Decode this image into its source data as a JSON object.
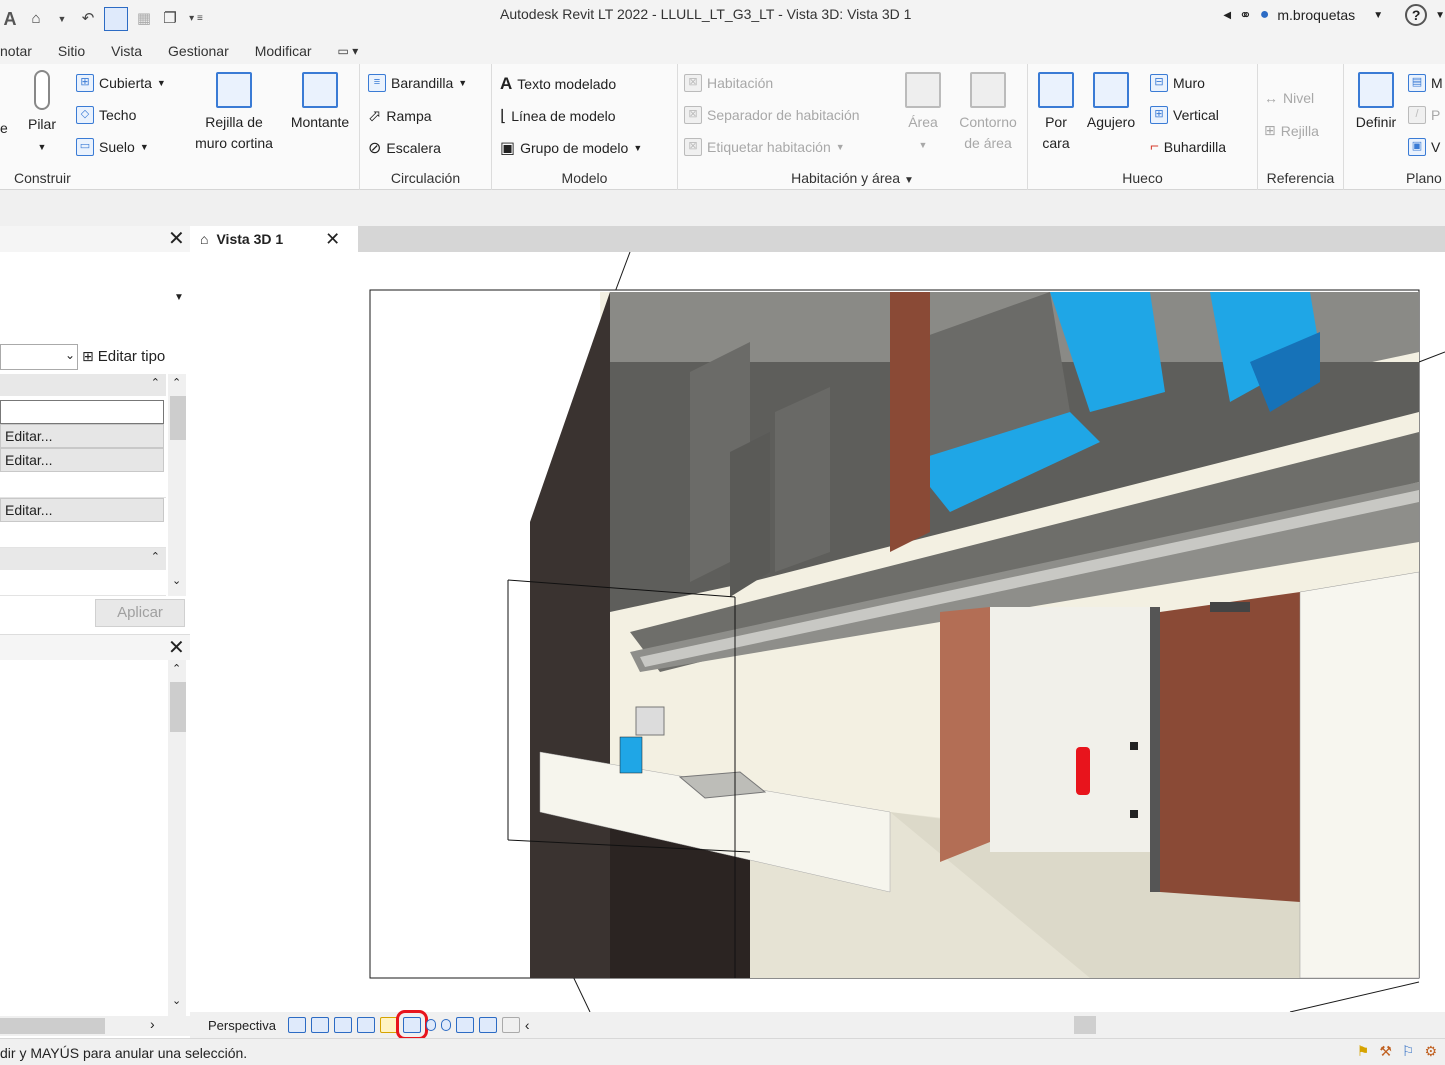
{
  "titlebar": {
    "app_title": "Autodesk Revit LT 2022 - LLULL_LT_G3_LT - Vista 3D: Vista 3D 1",
    "user": "m.broquetas",
    "help": "?"
  },
  "menu": {
    "tabs": [
      "notar",
      "Sitio",
      "Vista",
      "Gestionar",
      "Modificar"
    ]
  },
  "ribbon": {
    "construir": {
      "title": "Construir",
      "left_cut": "e",
      "pilar": "Pilar",
      "cubierta": "Cubierta",
      "techo": "Techo",
      "suelo": "Suelo",
      "rejilla_1": "Rejilla de",
      "rejilla_2": "muro cortina",
      "montante": "Montante"
    },
    "circulacion": {
      "title": "Circulación",
      "barandilla": "Barandilla",
      "rampa": "Rampa",
      "escalera": "Escalera"
    },
    "modelo": {
      "title": "Modelo",
      "texto": "Texto modelado",
      "linea": "Línea de modelo",
      "grupo": "Grupo de modelo"
    },
    "habitacion": {
      "title": "Habitación y área",
      "habitacion": "Habitación",
      "separador": "Separador de habitación",
      "etiquetar": "Etiquetar habitación",
      "area": "Área",
      "contorno_1": "Contorno",
      "contorno_2": "de área"
    },
    "hueco": {
      "title": "Hueco",
      "por_1": "Por",
      "por_2": "cara",
      "agujero": "Agujero",
      "muro": "Muro",
      "vertical": "Vertical",
      "buhardilla": "Buhardilla"
    },
    "referencia": {
      "title": "Referencia",
      "nivel": "Nivel",
      "rejilla": "Rejilla"
    },
    "plano": {
      "title": "Plano",
      "definir": "Definir",
      "m": "M",
      "p": "P",
      "v": "V"
    }
  },
  "properties": {
    "edit_type": "Editar tipo",
    "edit_1": "Editar...",
    "edit_2": "Editar...",
    "edit_3": "Editar...",
    "apply": "Aplicar"
  },
  "view": {
    "tab_label": "Vista 3D 1",
    "perspective": "Perspectiva"
  },
  "status": {
    "text": "dir y MAYÚS para anular una selección."
  },
  "colors": {
    "duct_blue": "#1fa6e6",
    "door_brown": "#8a4a36",
    "wall_cream": "#f3f0e2",
    "ceiling_grey": "#6b6b68",
    "highlight_red": "#e8141c"
  }
}
